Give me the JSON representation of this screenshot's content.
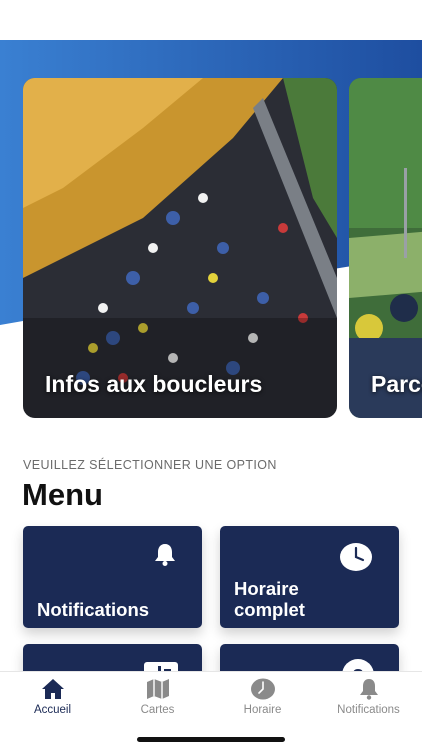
{
  "carousel": {
    "cards": [
      {
        "title": "Infos aux boucleurs"
      },
      {
        "title": "Parcours"
      }
    ]
  },
  "menu": {
    "section_label": "VEUILLEZ SÉLECTIONNER UNE OPTION",
    "title": "Menu",
    "tiles": [
      {
        "label": "Notifications",
        "icon": "bell-icon"
      },
      {
        "label": "Horaire complet",
        "icon": "clock-icon"
      },
      {
        "label": "",
        "icon": "route-sign-icon"
      },
      {
        "label": "",
        "icon": "question-icon"
      }
    ]
  },
  "tabbar": {
    "tabs": [
      {
        "label": "Accueil",
        "icon": "home-icon",
        "active": true
      },
      {
        "label": "Cartes",
        "icon": "map-icon",
        "active": false
      },
      {
        "label": "Horaire",
        "icon": "clock-icon",
        "active": false
      },
      {
        "label": "Notifications",
        "icon": "bell-icon",
        "active": false
      }
    ]
  },
  "colors": {
    "primary": "#1b2a55",
    "hero_blue": "#2c63b8",
    "inactive": "#8a8a8a"
  }
}
